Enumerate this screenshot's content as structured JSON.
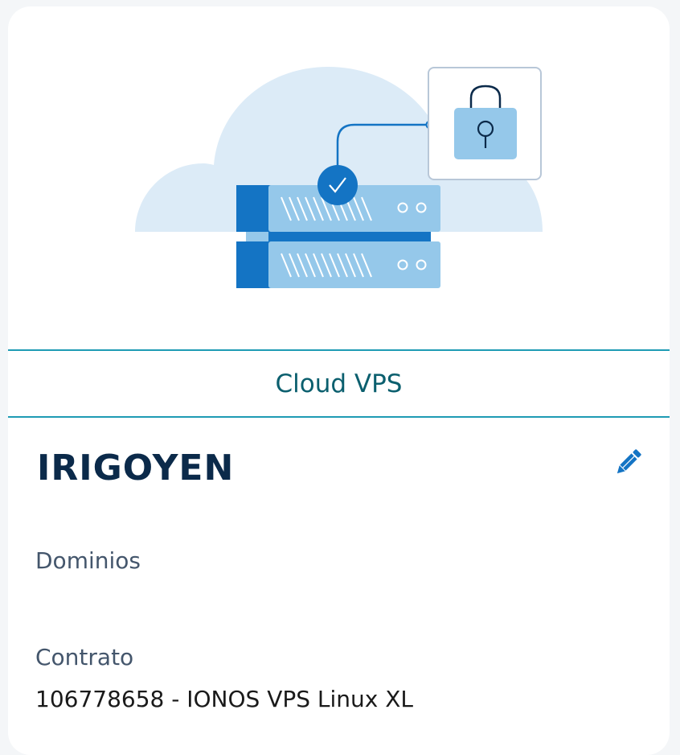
{
  "card": {
    "product_type": "Cloud VPS",
    "server_name": "IRIGOYEN",
    "domains": {
      "label": "Dominios",
      "value": ""
    },
    "contract": {
      "label": "Contrato",
      "value": "106778658 - IONOS VPS Linux XL"
    }
  },
  "icons": {
    "edit": "pencil-icon",
    "illustration": "cloud-server-lock-illustration"
  },
  "colors": {
    "accent": "#1e9bb4",
    "brand_blue": "#1474c4",
    "title": "#0b2a4a"
  }
}
